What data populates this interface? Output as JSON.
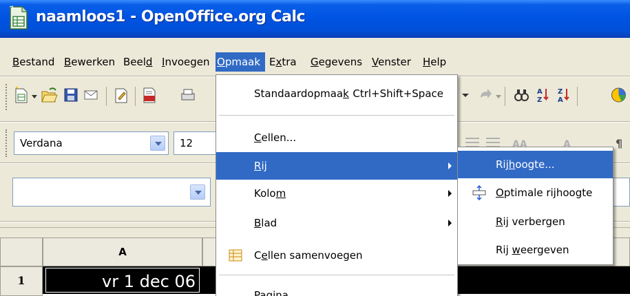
{
  "window": {
    "title": "naamloos1 - OpenOffice.org Calc"
  },
  "menubar": [
    {
      "label": "Bestand",
      "active": false
    },
    {
      "label": "Bewerken",
      "active": false
    },
    {
      "label": "Beeld",
      "active": false
    },
    {
      "label": "Invoegen",
      "active": false
    },
    {
      "label": "Opmaak",
      "active": true
    },
    {
      "label": "Extra",
      "active": false
    },
    {
      "label": "Gegevens",
      "active": false
    },
    {
      "label": "Venster",
      "active": false
    },
    {
      "label": "Help",
      "active": false
    }
  ],
  "format_bar": {
    "font_name": "Verdana",
    "font_size": "12"
  },
  "sheet": {
    "column_header": "A",
    "row_header": "1",
    "cell_a1": "vr 1 dec 06"
  },
  "opmaak_menu": {
    "items": [
      {
        "label": "Standaardopmaak",
        "shortcut": "Ctrl+Shift+Space"
      },
      {
        "label": "Cellen..."
      },
      {
        "label": "Rij",
        "submenu": true,
        "highlighted": true
      },
      {
        "label": "Kolom",
        "submenu": true
      },
      {
        "label": "Blad",
        "submenu": true
      },
      {
        "label": "Cellen samenvoegen",
        "icon": "merge-cells-icon"
      },
      {
        "label": "Pagina"
      }
    ]
  },
  "rij_submenu": {
    "items": [
      {
        "label": "Rijhoogte...",
        "highlighted": true
      },
      {
        "label": "Optimale rijhoogte",
        "icon": "optimal-row-height-icon"
      },
      {
        "label": "Rij verbergen"
      },
      {
        "label": "Rij weergeven"
      }
    ]
  },
  "colors": {
    "title_bar": "#0054e3",
    "highlight": "#316ac5",
    "menu_bg": "#ece9d8"
  }
}
